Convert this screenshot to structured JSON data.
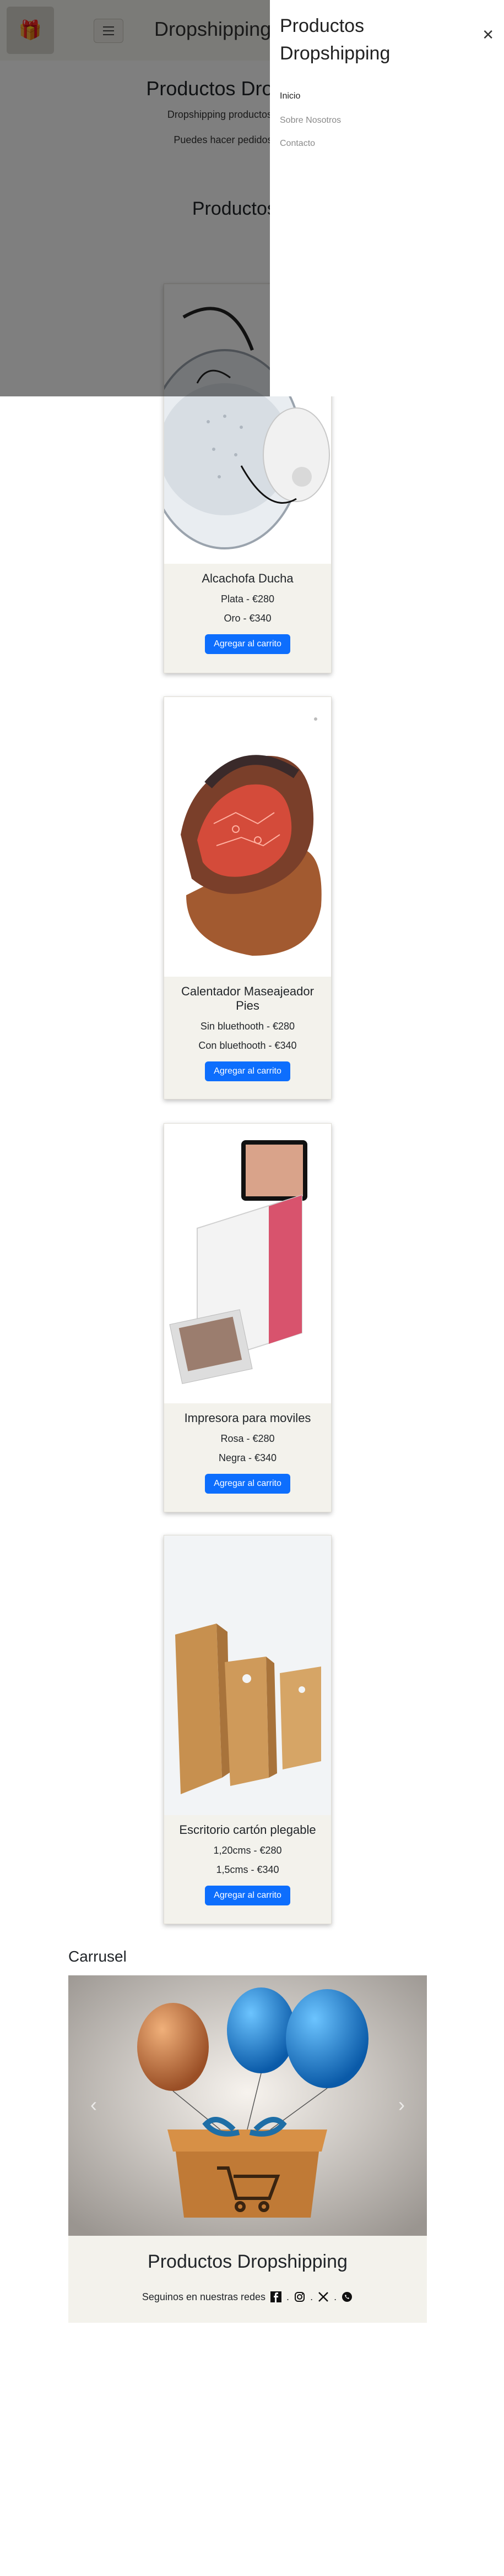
{
  "navbar": {
    "brand": "Dropshipping",
    "logo_icon": "gift-logo-icon",
    "toggler_icon": "hamburger-icon"
  },
  "hero": {
    "title": "Productos Dropshipping",
    "line1": "Dropshipping productos innovadores y",
    "line2": "Puedes hacer pedidos especiales q"
  },
  "section": {
    "title": "Productos des"
  },
  "products": [
    {
      "name": "Alcachofa Ducha",
      "options": [
        "Plata - €280",
        "Oro - €340"
      ],
      "button": "Agregar al carrito"
    },
    {
      "name": "Calentador Maseajeador Pies",
      "options": [
        "Sin bluethooth - €280",
        "Con bluethooth - €340"
      ],
      "button": "Agregar al carrito"
    },
    {
      "name": "Impresora para moviles",
      "options": [
        "Rosa - €280",
        "Negra - €340"
      ],
      "button": "Agregar al carrito"
    },
    {
      "name": "Escritorio cartón plegable",
      "options": [
        "1,20cms - €280",
        "1,5cms - €340"
      ],
      "button": "Agregar al carrito"
    }
  ],
  "carousel": {
    "title": "Carrusel",
    "prev_icon": "chevron-left-icon",
    "next_icon": "chevron-right-icon"
  },
  "footer": {
    "title": "Productos Dropshipping",
    "social_text": "Seguinos en nuestras redes",
    "separator": ".",
    "icons": [
      "facebook-icon",
      "instagram-icon",
      "x-icon",
      "whatsapp-icon"
    ]
  },
  "offcanvas": {
    "title_line1": "Productos",
    "title_line2": "Dropshipping",
    "close_icon": "close-icon",
    "links": [
      "Inicio",
      "Sobre Nosotros",
      "Contacto"
    ]
  },
  "colors": {
    "primary": "#0d6efd",
    "card_bg": "#f3f2ec",
    "backdrop": "rgba(0,0,0,0.5)"
  }
}
